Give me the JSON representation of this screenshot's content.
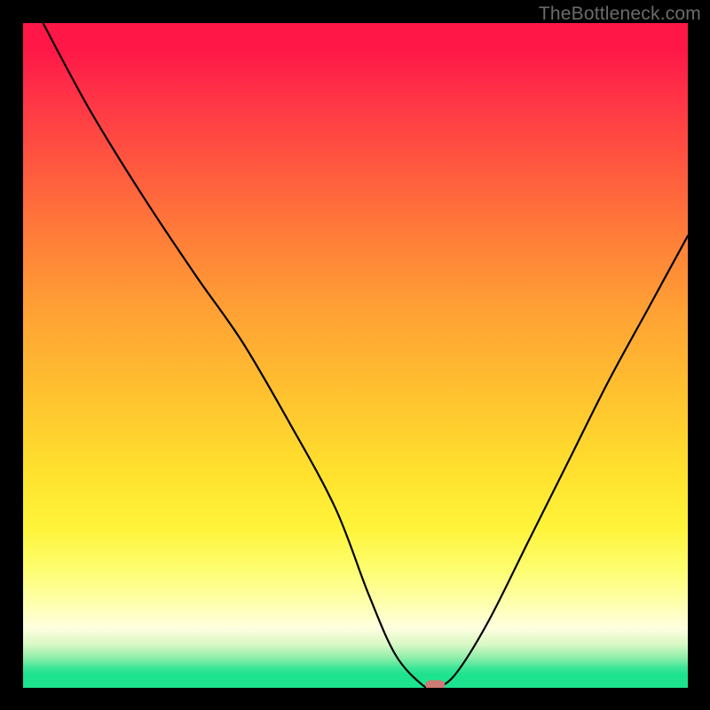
{
  "watermark": "TheBottleneck.com",
  "colors": {
    "top": "#ff1747",
    "mid": "#ffe22e",
    "bottom": "#1de28e",
    "curve": "#000000",
    "marker": "#cf7a74"
  },
  "chart_data": {
    "type": "line",
    "title": "",
    "xlabel": "",
    "ylabel": "",
    "xlim": [
      0,
      100
    ],
    "ylim": [
      0,
      100
    ],
    "x": [
      3,
      10,
      18,
      26,
      33,
      40,
      47,
      52,
      56,
      60,
      62,
      65,
      70,
      76,
      82,
      88,
      94,
      100
    ],
    "values": [
      100,
      87,
      74,
      62,
      52,
      40,
      27,
      14,
      5,
      0.5,
      0,
      2,
      10,
      22,
      34,
      46,
      57,
      68
    ],
    "minimum": {
      "x": 62,
      "y": 0
    },
    "series": [
      {
        "name": "bottleneck-curve",
        "x": [
          3,
          10,
          18,
          26,
          33,
          40,
          47,
          52,
          56,
          60,
          62,
          65,
          70,
          76,
          82,
          88,
          94,
          100
        ],
        "values": [
          100,
          87,
          74,
          62,
          52,
          40,
          27,
          14,
          5,
          0.5,
          0,
          2,
          10,
          22,
          34,
          46,
          57,
          68
        ]
      }
    ]
  }
}
